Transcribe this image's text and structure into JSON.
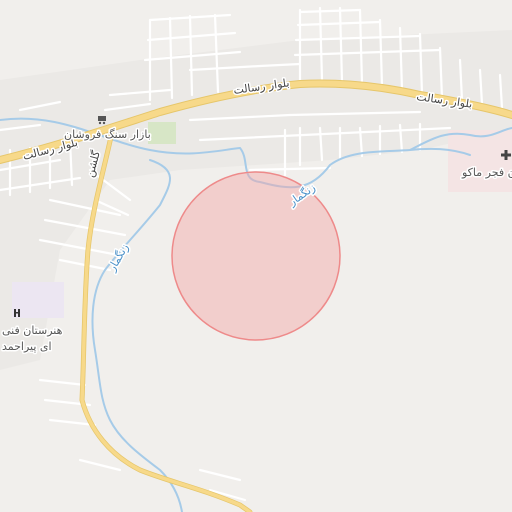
{
  "map": {
    "streets": {
      "resalat_1": "بلوار رسالت",
      "resalat_2": "بلوار رسالت",
      "resalat_3": "بلوار رسالت",
      "golshan": "گلشن"
    },
    "places": {
      "stone_bazaar": "بازار سنگ فروشان",
      "hospital": "ن فجر ماکو",
      "school_line1": "هنرستان فنی",
      "school_line2": "ای پیراحمد"
    },
    "water": {
      "river_1": "زنگمار",
      "river_2": "زنگمار"
    },
    "icons": {
      "shop": "shopping-cart-icon",
      "hospital": "hospital-cross-icon",
      "school": "school-icon"
    },
    "colors": {
      "background": "#f1efec",
      "main_road": "#f7d98a",
      "main_road_casing": "#e6c66a",
      "minor_road": "#ffffff",
      "river": "#a6cbe8",
      "circle_fill": "#f4a6a6",
      "circle_stroke": "#ee8a8a",
      "park": "#d7e6c6",
      "school_area": "#ece6f2",
      "hospital_area": "#f4e4e4"
    }
  }
}
